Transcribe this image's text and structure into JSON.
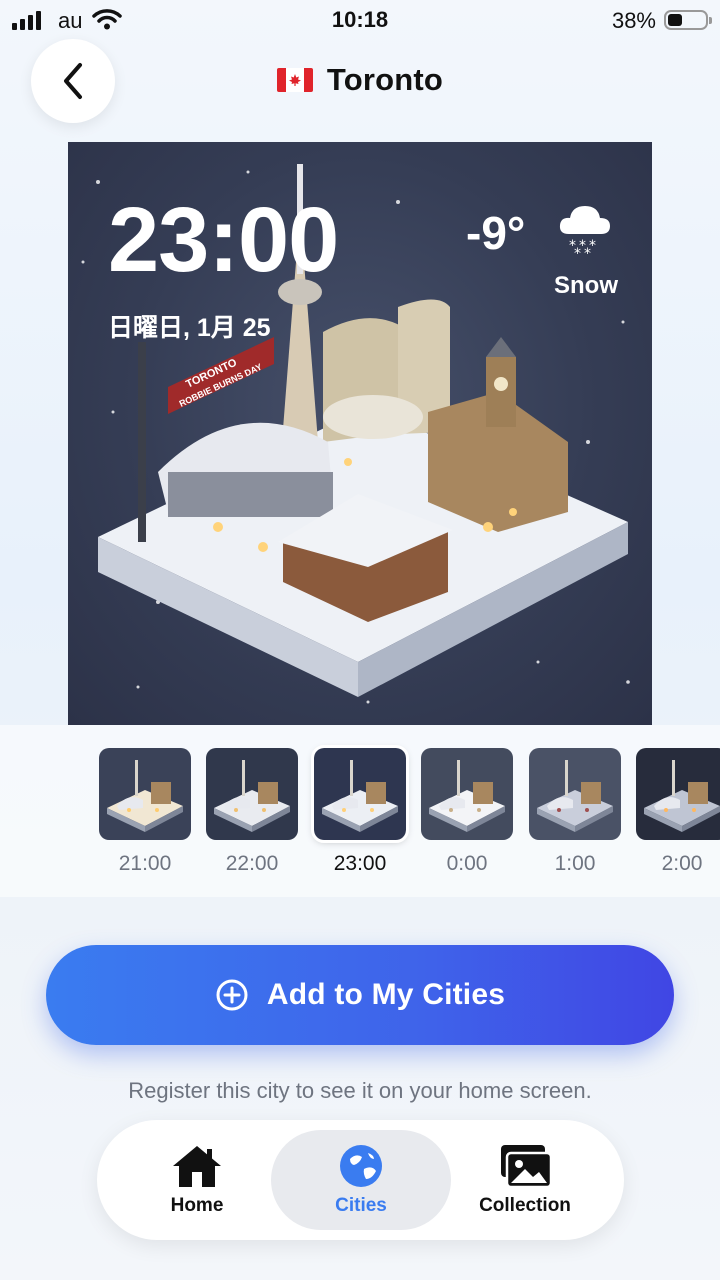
{
  "status_bar": {
    "carrier": "au",
    "time": "10:18",
    "battery_percent": "38%",
    "battery_level": 0.38
  },
  "header": {
    "title": "Toronto",
    "flag": "canada-flag-icon",
    "back_icon": "chevron-left-icon"
  },
  "hero": {
    "time": "23:00",
    "date": "日曜日, 1月 25",
    "temperature": "-9°",
    "condition": "Snow",
    "condition_icon": "snow-cloud-icon",
    "banner_line1": "TORONTO",
    "banner_line2": "ROBBIE BURNS DAY"
  },
  "timeline": {
    "items": [
      {
        "label": "21:00",
        "selected": false
      },
      {
        "label": "22:00",
        "selected": false
      },
      {
        "label": "23:00",
        "selected": true
      },
      {
        "label": "0:00",
        "selected": false
      },
      {
        "label": "1:00",
        "selected": false
      },
      {
        "label": "2:00",
        "selected": false
      }
    ]
  },
  "actions": {
    "add_label": "Add to My Cities",
    "add_icon": "plus-circle-icon",
    "hint": "Register this city to see it on your home screen."
  },
  "nav": {
    "items": [
      {
        "label": "Home",
        "icon": "home-icon",
        "active": false
      },
      {
        "label": "Cities",
        "icon": "globe-icon",
        "active": true
      },
      {
        "label": "Collection",
        "icon": "gallery-icon",
        "active": false
      }
    ]
  },
  "colors": {
    "accent": "#3a7cf0",
    "button_end": "#4046e4",
    "hero_bg": "#353d55"
  }
}
